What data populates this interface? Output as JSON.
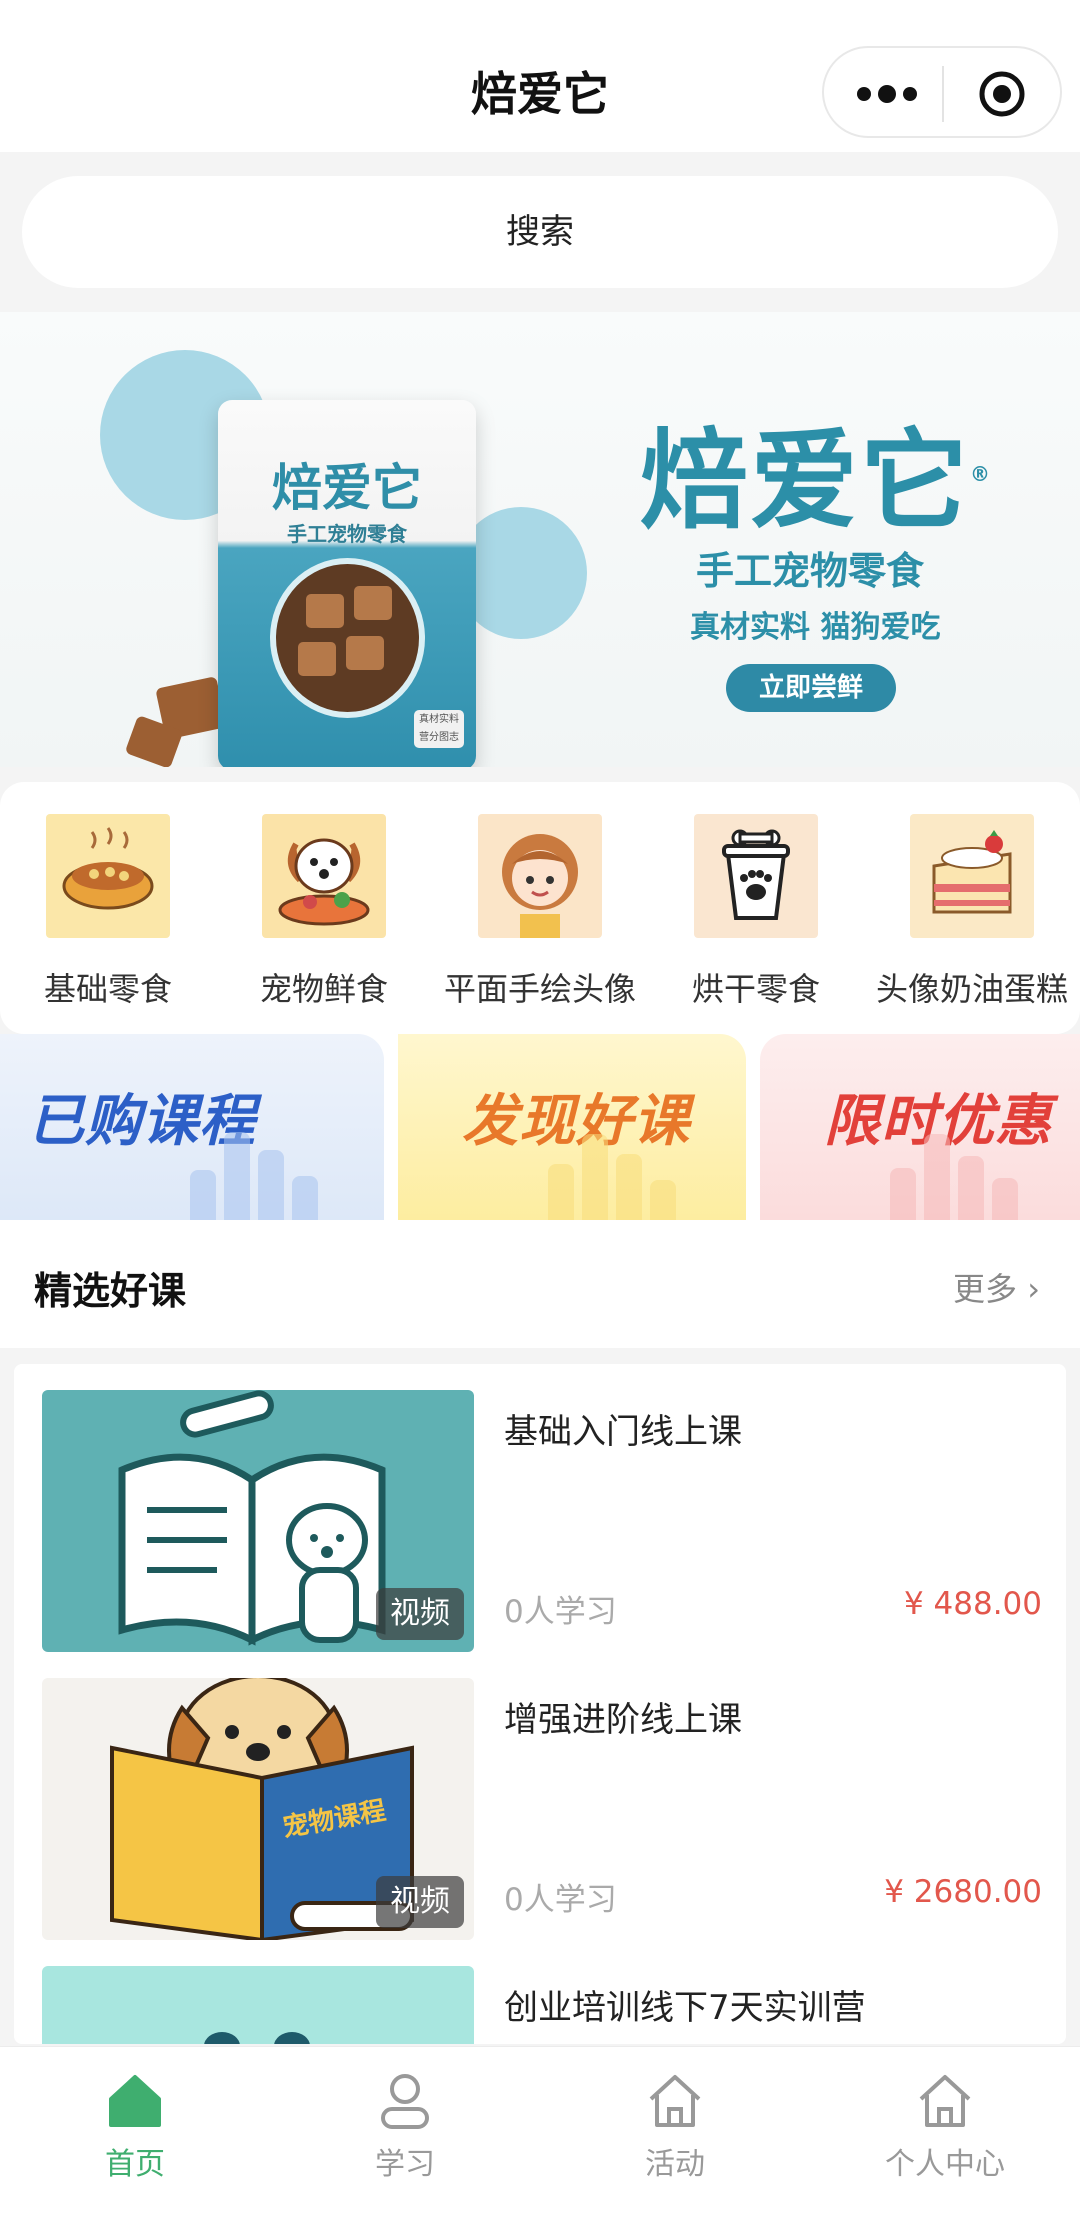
{
  "header": {
    "title": "焙爱它",
    "more_icon": "more-dots-icon",
    "target_icon": "target-icon"
  },
  "search": {
    "placeholder": "搜索"
  },
  "banner": {
    "bag_brand": "焙爱它",
    "bag_subtitle": "手工宠物零食",
    "bag_tag": "真材实料 营分图志",
    "brand": "焙爱它",
    "registered": "®",
    "tagline": "手工宠物零食",
    "tagline2": "真材实料 猫狗爱吃",
    "cta": "立即尝鲜",
    "accent": "#2c8fa8"
  },
  "categories": [
    {
      "label": "基础零食",
      "icon": "food-bowl-icon"
    },
    {
      "label": "宠物鲜食",
      "icon": "dog-food-icon"
    },
    {
      "label": "平面手绘头像",
      "icon": "portrait-icon"
    },
    {
      "label": "烘干零食",
      "icon": "paw-cup-icon"
    },
    {
      "label": "头像奶油蛋糕",
      "icon": "cake-icon"
    }
  ],
  "promos": [
    {
      "label": "已购课程",
      "color": "#2c5fc7"
    },
    {
      "label": "发现好课",
      "color": "#e8782a"
    },
    {
      "label": "限时优惠",
      "color": "#e2403a"
    }
  ],
  "section": {
    "title": "精选好课",
    "more": "更多"
  },
  "courses": [
    {
      "title": "基础入门线上课",
      "badge": "视频",
      "learners": "0人学习",
      "price": "¥ 488.00"
    },
    {
      "title": "增强进阶线上课",
      "badge": "视频",
      "learners": "0人学习",
      "price": "¥ 2680.00",
      "book_text": "宠物课程"
    },
    {
      "title": "创业培训线下7天实训营"
    }
  ],
  "tabbar": [
    {
      "label": "首页",
      "icon": "home-icon",
      "active": true
    },
    {
      "label": "学习",
      "icon": "user-icon"
    },
    {
      "label": "活动",
      "icon": "house-icon"
    },
    {
      "label": "个人中心",
      "icon": "house-icon"
    }
  ],
  "colors": {
    "active_green": "#3fae6f",
    "price_red": "#e2574c"
  }
}
